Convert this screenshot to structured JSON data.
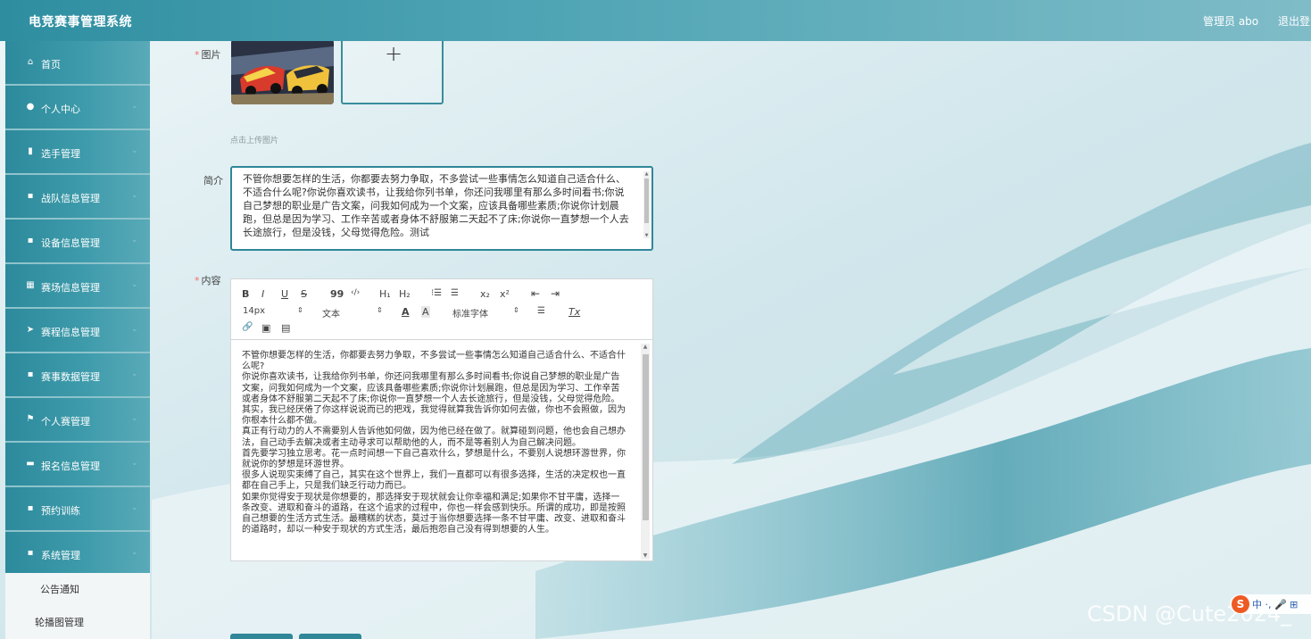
{
  "header": {
    "title": "电竞赛事管理系统",
    "user": "管理员 abo",
    "logout": "退出登"
  },
  "sidebar": {
    "items": [
      {
        "label": "首页",
        "icon": "home-icon",
        "glyph": "⌂"
      },
      {
        "label": "个人中心",
        "icon": "user-icon",
        "glyph": "●"
      },
      {
        "label": "选手管理",
        "icon": "clipboard-icon",
        "glyph": "▮"
      },
      {
        "label": "战队信息管理",
        "icon": "grid-icon",
        "glyph": "▪"
      },
      {
        "label": "设备信息管理",
        "icon": "grid-icon",
        "glyph": "▪"
      },
      {
        "label": "赛场信息管理",
        "icon": "table-icon",
        "glyph": "▦"
      },
      {
        "label": "赛程信息管理",
        "icon": "send-icon",
        "glyph": "➤"
      },
      {
        "label": "赛事数据管理",
        "icon": "grid-icon",
        "glyph": "▪"
      },
      {
        "label": "个人赛管理",
        "icon": "flag-icon",
        "glyph": "⚑"
      },
      {
        "label": "报名信息管理",
        "icon": "briefcase-icon",
        "glyph": "▬"
      },
      {
        "label": "预约训练",
        "icon": "grid-icon",
        "glyph": "▪"
      },
      {
        "label": "系统管理",
        "icon": "grid-icon",
        "glyph": "▪"
      }
    ],
    "chevron": "⌄",
    "submenu": [
      "公告通知",
      "轮播图管理"
    ]
  },
  "form": {
    "required_mark": "*",
    "image_label": "图片",
    "upload_plus": "+",
    "upload_hint": "点击上传图片",
    "intro_label": "简介",
    "intro_text": "不管你想要怎样的生活，你都要去努力争取，不多尝试一些事情怎么知道自己适合什么、不适合什么呢?你说你喜欢读书，让我给你列书单，你还问我哪里有那么多时间看书;你说自己梦想的职业是广告文案，问我如何成为一个文案，应该具备哪些素质;你说你计划晨跑，但总是因为学习、工作辛苦或者身体不舒服第二天起不了床;你说你一直梦想一个人去长途旅行，但是没钱，父母觉得危险。测试",
    "content_label": "内容"
  },
  "editor": {
    "toolbar": {
      "bold": "B",
      "italic": "I",
      "underline": "U",
      "strike": "S",
      "quote": "99",
      "code": "‹/›",
      "h1": "H₁",
      "h2": "H₂",
      "ordered_list": "⁝☰",
      "bullet_list": "☰",
      "subscript": "x₂",
      "superscript": "x²",
      "indent_left": "⇤",
      "indent_right": "⇥",
      "font_size": "14px",
      "header_select": "文本",
      "color": "A",
      "background": "A",
      "font_family": "标准字体",
      "align": "☰",
      "clean": "Tx",
      "link": "🔗",
      "image": "▣",
      "video": "▤"
    },
    "paragraphs": [
      "不管你想要怎样的生活，你都要去努力争取，不多尝试一些事情怎么知道自己适合什么、不适合什么呢?",
      "你说你喜欢读书，让我给你列书单，你还问我哪里有那么多时间看书;你说自己梦想的职业是广告文案，问我如何成为一个文案，应该具备哪些素质;你说你计划晨跑，但总是因为学习、工作辛苦或者身体不舒服第二天起不了床;你说你一直梦想一个人去长途旅行，但是没钱，父母觉得危险。其实，我已经厌倦了你这样说说而已的把戏，我觉得就算我告诉你如何去做，你也不会照做，因为你根本什么都不做。",
      "真正有行动力的人不需要别人告诉他如何做，因为他已经在做了。就算碰到问题，他也会自己想办法，自己动手去解决或者主动寻求可以帮助他的人，而不是等着别人为自己解决问题。",
      "首先要学习独立思考。花一点时间想一下自己喜欢什么，梦想是什么，不要别人说想环游世界，你就说你的梦想是环游世界。",
      "很多人说现实束缚了自己，其实在这个世界上，我们一直都可以有很多选择，生活的决定权也一直都在自己手上，只是我们缺乏行动力而已。",
      "如果你觉得安于现状是你想要的，那选择安于现状就会让你幸福和满足;如果你不甘平庸，选择一条改变、进取和奋斗的道路，在这个追求的过程中，你也一样会感到快乐。所谓的成功，即是按照自己想要的生活方式生活。最糟糕的状态，莫过于当你想要选择一条不甘平庸、改变、进取和奋斗的道路时，却以一种安于现状的方式生活，最后抱怨自己没有得到想要的人生。"
    ]
  },
  "overlay": {
    "watermark": "CSDN @Cute2024_",
    "ime_logo": "S",
    "ime_text": "中 ·, 🎤 ⊞"
  },
  "colors": {
    "accent": "#2f8798",
    "sidebar": "#3e9bab",
    "required": "#f56c6c"
  }
}
